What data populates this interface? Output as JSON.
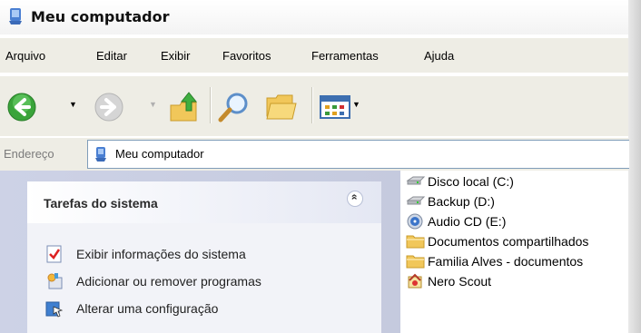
{
  "window": {
    "title": "Meu computador"
  },
  "menu": [
    "Arquivo",
    "Editar",
    "Exibir",
    "Favoritos",
    "Ferramentas",
    "Ajuda"
  ],
  "toolbar": {
    "icons": [
      "back-icon",
      "forward-icon",
      "up-folder-icon",
      "search-icon",
      "folders-icon",
      "views-icon"
    ]
  },
  "address": {
    "label": "Endereço",
    "value": "Meu computador"
  },
  "tasks": {
    "title": "Tarefas do sistema",
    "collapse_glyph": "»",
    "items": [
      {
        "label": "Exibir informações do sistema",
        "icon": "system-info-icon"
      },
      {
        "label": "Adicionar ou remover programas",
        "icon": "add-remove-icon"
      },
      {
        "label": "Alterar uma configuração",
        "icon": "control-panel-icon"
      }
    ]
  },
  "files": [
    {
      "label": "Disco local (C:)",
      "icon": "drive-icon"
    },
    {
      "label": "Backup (D:)",
      "icon": "drive-icon"
    },
    {
      "label": "Audio CD (E:)",
      "icon": "cd-icon"
    },
    {
      "label": "Documentos compartilhados",
      "icon": "folder-icon"
    },
    {
      "label": "Familia Alves - documentos",
      "icon": "folder-icon"
    },
    {
      "label": "Nero Scout",
      "icon": "nero-icon"
    }
  ],
  "colors": {
    "chrome": "#eeede5",
    "task_pane": "#c7cce0",
    "back_green": "#3aa43a"
  }
}
